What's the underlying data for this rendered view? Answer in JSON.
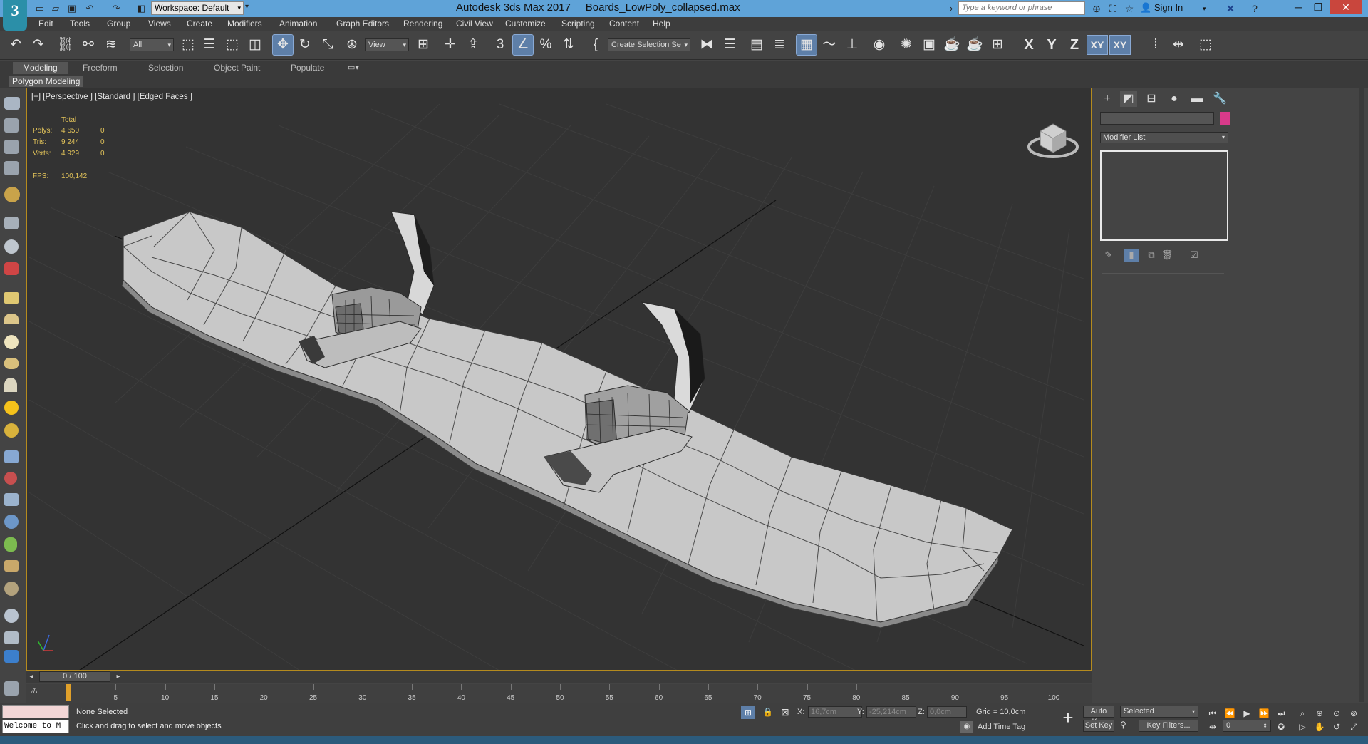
{
  "app": {
    "logo": "3",
    "title": "Autodesk 3ds Max 2017",
    "file_name": "Boards_LowPoly_collapsed.max",
    "workspace": "Workspace: Default",
    "search_placeholder": "Type a keyword or phrase",
    "sign_in": "Sign In"
  },
  "menu": [
    "Edit",
    "Tools",
    "Group",
    "Views",
    "Create",
    "Modifiers",
    "Animation",
    "Graph Editors",
    "Rendering",
    "Civil View",
    "Customize",
    "Scripting",
    "Content",
    "Help"
  ],
  "toolbar": {
    "selection_filter": "All",
    "ref_coord": "View",
    "named_selection": "Create Selection Se",
    "axis_x": "X",
    "axis_y": "Y",
    "axis_z": "Z",
    "axis_xy": "XY",
    "axis_xy2": "XY"
  },
  "ribbon": {
    "tabs": [
      "Modeling",
      "Freeform",
      "Selection",
      "Object Paint",
      "Populate"
    ],
    "active_tab": "Modeling",
    "panel": "Polygon Modeling"
  },
  "viewport": {
    "label": "[+] [Perspective ] [Standard ] [Edged Faces ]",
    "stats": {
      "header": "Total",
      "rows": [
        {
          "label": "Polys:",
          "total": "4 650",
          "sel": "0"
        },
        {
          "label": "Tris:",
          "total": "9 244",
          "sel": "0"
        },
        {
          "label": "Verts:",
          "total": "4 929",
          "sel": "0"
        }
      ],
      "fps_label": "FPS:",
      "fps_value": "100,142"
    }
  },
  "command_panel": {
    "modifier_list": "Modifier List",
    "object_color": "#d83a8a"
  },
  "timeline": {
    "slider": "0 / 100",
    "ticks": [
      "5",
      "10",
      "15",
      "20",
      "25",
      "30",
      "35",
      "40",
      "45",
      "50",
      "55",
      "60",
      "65",
      "70",
      "75",
      "80",
      "85",
      "90",
      "95",
      "100"
    ]
  },
  "status": {
    "maxscript_text": "Welcome to M",
    "selection": "None Selected",
    "prompt": "Click and drag to select and move objects",
    "x_label": "X:",
    "x_value": "16,7cm",
    "y_label": "Y:",
    "y_value": "-25,214cm",
    "z_label": "Z:",
    "z_value": "0,0cm",
    "grid": "Grid = 10,0cm",
    "add_time_tag": "Add Time Tag",
    "auto_key": "Auto Key",
    "set_key": "Set Key",
    "key_mode": "Selected",
    "key_filters": "Key Filters...",
    "current_frame": "0"
  }
}
